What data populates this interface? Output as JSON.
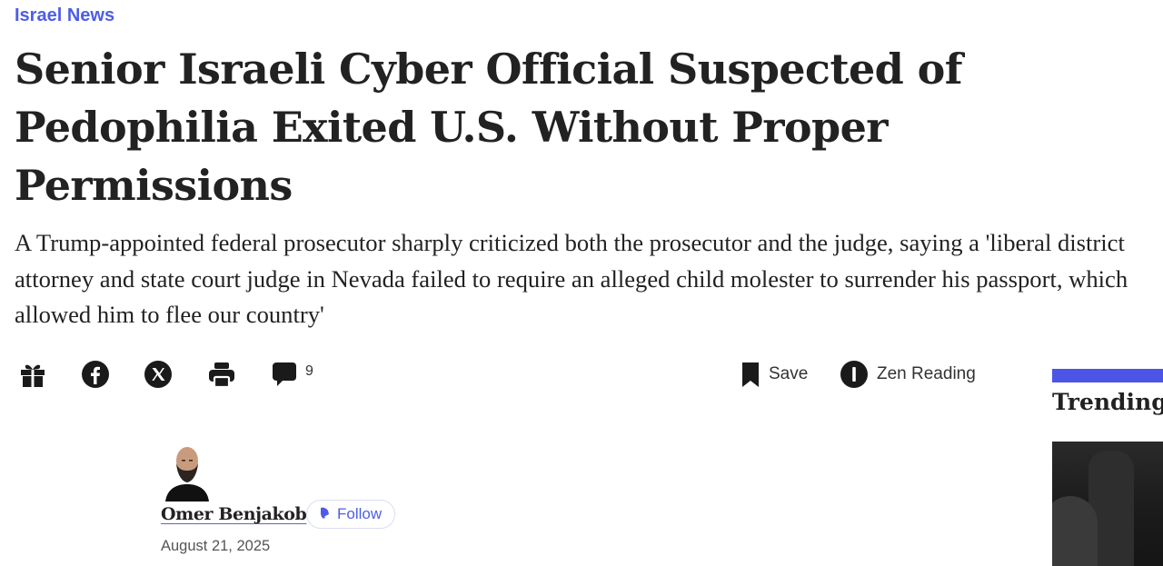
{
  "section": {
    "label": "Israel News"
  },
  "article": {
    "headline": "Senior Israeli Cyber Official Suspected of Pedophilia Exited U.S. Without Proper Permissions",
    "subtitle": "A Trump-appointed federal prosecutor sharply criticized both the prosecutor and the judge, saying a 'liberal district attorney and state court judge in Nevada failed to require an alleged child molester to surrender his passport, which allowed him to flee our country'"
  },
  "toolbar": {
    "icons": [
      "gift-icon",
      "facebook-icon",
      "x-icon",
      "print-icon",
      "comment-icon",
      "bookmark-icon",
      "zen-icon"
    ],
    "comment_count": "9",
    "save_label": "Save",
    "zen_label": "Zen Reading"
  },
  "author": {
    "name": "Omer Benjakob",
    "follow_label": "Follow",
    "date": "August 21, 2025"
  },
  "sidebar": {
    "trending_title": "Trending"
  },
  "colors": {
    "accent": "#4d5de8",
    "trending_bar": "#4c55e6",
    "text": "#222222"
  }
}
